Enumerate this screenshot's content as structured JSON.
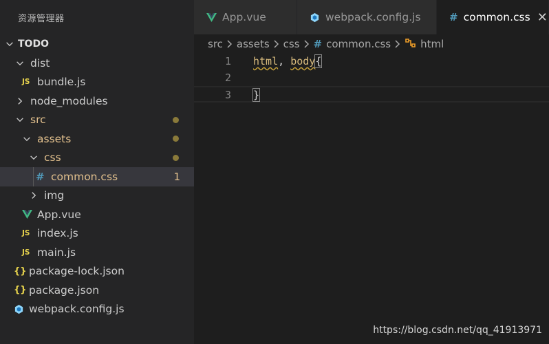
{
  "sidebar": {
    "title": "资源管理器",
    "section": "TODO",
    "tree": {
      "dist": "dist",
      "bundle": "bundle.js",
      "node_modules": "node_modules",
      "src": "src",
      "assets": "assets",
      "css": "css",
      "common_css": "common.css",
      "common_css_count": "1",
      "img": "img",
      "app_vue": "App.vue",
      "index_js": "index.js",
      "main_js": "main.js",
      "package_lock": "package-lock.json",
      "package_json": "package.json",
      "webpack_config": "webpack.config.js"
    },
    "js_badge": "JS",
    "json_badge": "{}",
    "css_badge": "#"
  },
  "tabs": [
    {
      "label": "App.vue"
    },
    {
      "label": "webpack.config.js"
    },
    {
      "label": "common.css",
      "close": "✕"
    }
  ],
  "breadcrumb": {
    "parts": [
      "src",
      "assets",
      "css",
      "common.css",
      "html"
    ]
  },
  "editor": {
    "lines": [
      {
        "num": "1",
        "selector": "html",
        "comma": ", ",
        "selector2": "body",
        "brace": "{"
      },
      {
        "num": "2"
      },
      {
        "num": "3",
        "brace": "}"
      }
    ]
  },
  "watermark": "https://blog.csdn.net/qq_41913971",
  "colors": {
    "sidebar_bg": "#252526",
    "editor_bg": "#1e1e1e",
    "modified": "#e2c08d",
    "vue": "#41b883",
    "css": "#519aba",
    "js": "#e8d44d"
  }
}
